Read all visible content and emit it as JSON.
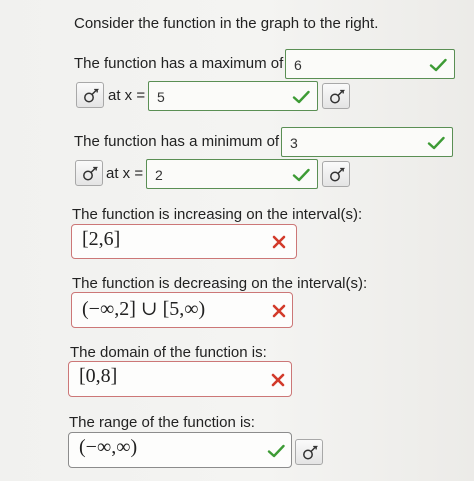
{
  "intro": "Consider the function in the graph to the right.",
  "maximum": {
    "prompt": "The function has a maximum of",
    "value": "6",
    "at_label": "at x =",
    "x_value": "5"
  },
  "minimum": {
    "prompt": "The function has a minimum of",
    "value": "3",
    "at_label": "at x =",
    "x_value": "2"
  },
  "increasing": {
    "prompt": "The function is increasing on the interval(s):",
    "answer": "[2,6]",
    "status": "incorrect"
  },
  "decreasing": {
    "prompt": "The function is decreasing on the interval(s):",
    "answer": "(−∞,2] ∪ [5,∞)",
    "status": "incorrect"
  },
  "domain": {
    "prompt": "The domain of the function is:",
    "answer": "[0,8]",
    "status": "incorrect"
  },
  "range": {
    "prompt": "The range of the function is:",
    "answer": "(−∞,∞)",
    "status": "correct"
  },
  "colors": {
    "correct": "#3d9b35",
    "incorrect": "#d23a2a",
    "field_border_correct": "#5a8f54",
    "field_border_incorrect": "#cc7777"
  },
  "icons": {
    "check": "checkmark-icon",
    "wrong": "x-mark-icon",
    "math_editor": "math-editor-icon"
  }
}
